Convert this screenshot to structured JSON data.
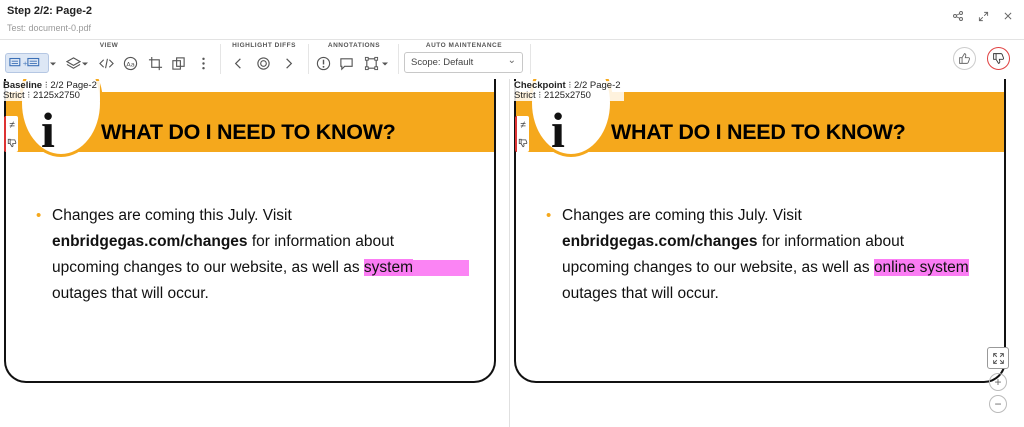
{
  "header": {
    "title": "Step 2/2: Page-2",
    "subtitle": "Test: document-0.pdf",
    "icons": [
      "share-icon",
      "expand-icon",
      "close-icon"
    ]
  },
  "toolbar": {
    "groups": {
      "view": "VIEW",
      "highlight": "HIGHLIGHT DIFFS",
      "annotations": "ANNOTATIONS",
      "auto": "AUTO MAINTENANCE"
    },
    "scope_value": "Scope: Default"
  },
  "panels": {
    "left": {
      "name": "Baseline",
      "info": "2/2 Page-2",
      "strict_label": "Strict",
      "size": "2125x2750"
    },
    "right": {
      "name": "Checkpoint",
      "info": "2/2 Page-2",
      "strict_label": "Strict",
      "size": "2125x2750"
    }
  },
  "doc": {
    "heading": "WHAT DO I NEED TO KNOW?",
    "line1": "Changes are coming this July. Visit",
    "link": "enbridgegas.com/changes",
    "line2_rest": " for information about",
    "line3_start": "upcoming changes to our website, as well as ",
    "left_diff_word": "system",
    "right_diff_word1": "online",
    "right_diff_word2": " system",
    "line4": "outages that will occur."
  },
  "colors": {
    "accent": "#f5a81c",
    "highlight": "#fa50f0",
    "reject": "#e04040"
  }
}
